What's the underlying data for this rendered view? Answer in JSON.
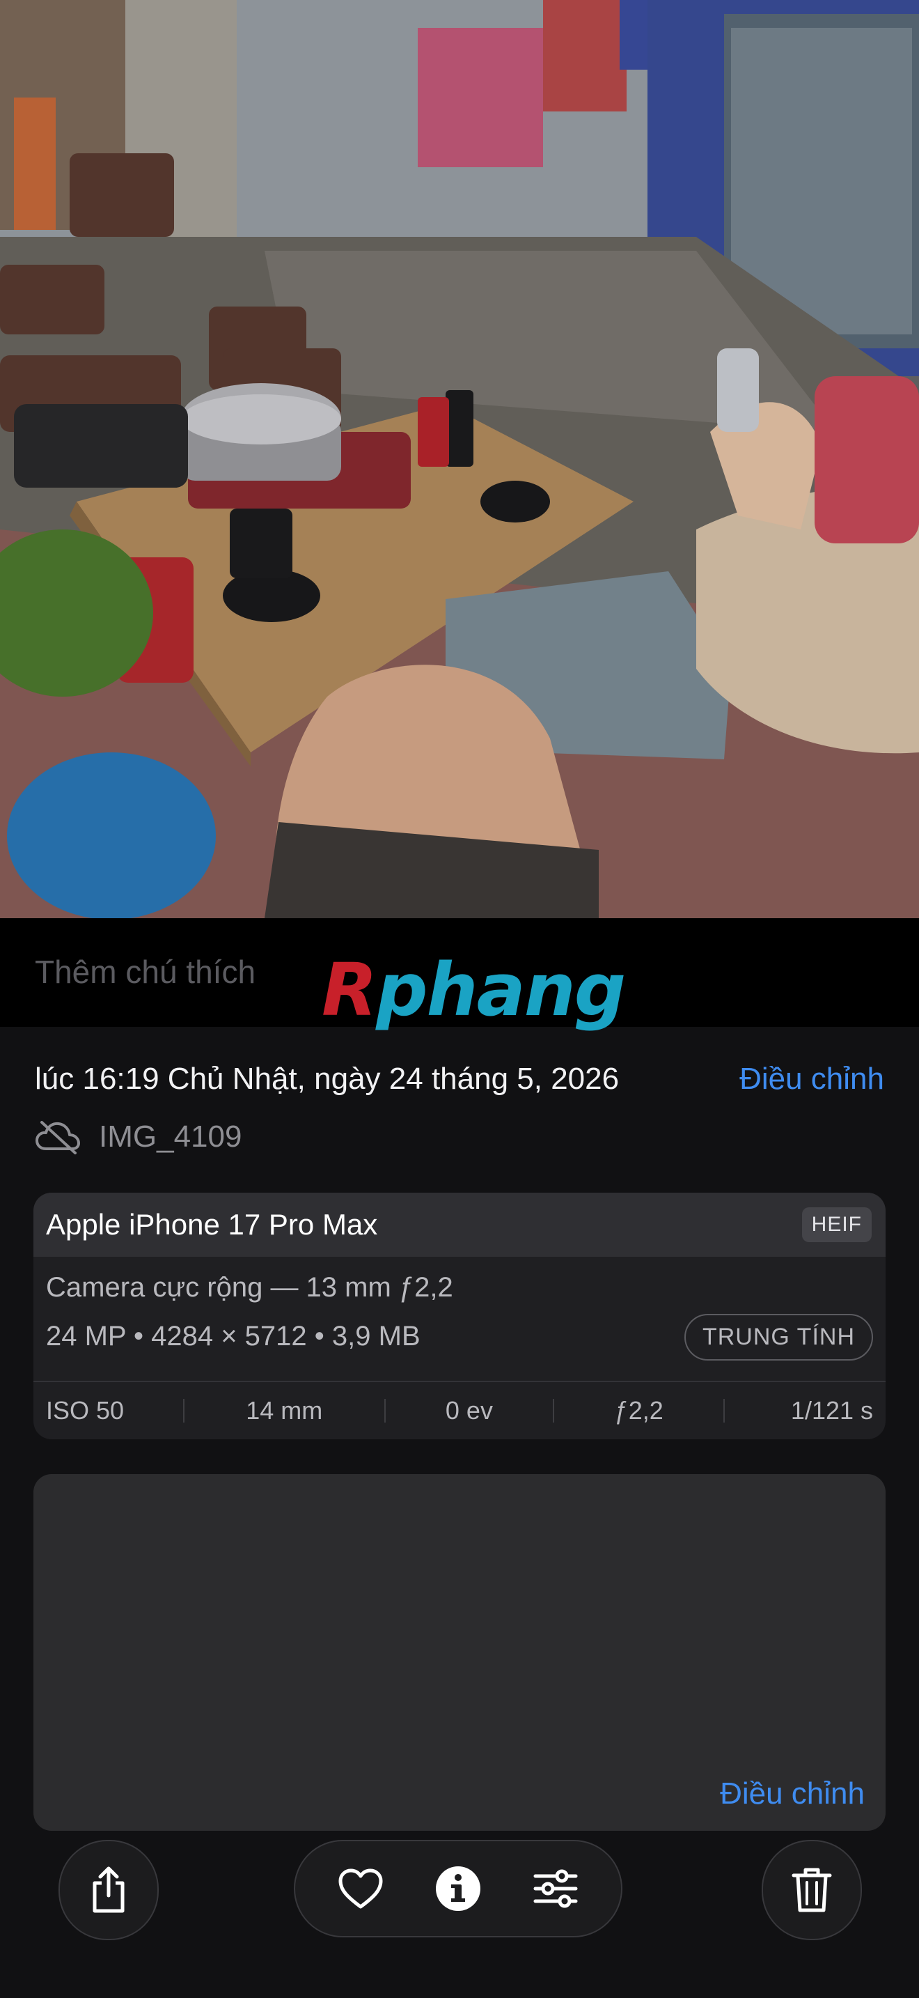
{
  "caption": {
    "placeholder": "Thêm chú thích"
  },
  "watermark": {
    "first": "R",
    "rest": "phang"
  },
  "meta": {
    "datetime": "lúc 16:19 Chủ Nhật, ngày 24 tháng 5, 2026",
    "adjust_label": "Điều chỉnh",
    "filename": "IMG_4109",
    "cloud_icon": "cloud-off-icon"
  },
  "exif": {
    "device": "Apple iPhone 17 Pro Max",
    "format": "HEIF",
    "lens": "Camera cực rộng — 13 mm ƒ2,2",
    "specs": "24 MP • 4284 × 5712 • 3,9 MB",
    "profile": "TRUNG TÍNH",
    "iso": "ISO 50",
    "focal": "14 mm",
    "ev": "0 ev",
    "aperture": "ƒ2,2",
    "shutter": "1/121 s"
  },
  "map": {
    "adjust_label": "Điều chỉnh"
  },
  "toolbar": {
    "share_icon": "share-icon",
    "favorite_icon": "heart-icon",
    "info_icon": "info-icon",
    "edit_icon": "sliders-icon",
    "delete_icon": "trash-icon"
  },
  "colors": {
    "background": "#111113",
    "accent": "#3f8cf0",
    "card": "#1f1f22",
    "card_header": "#2f2f33"
  }
}
